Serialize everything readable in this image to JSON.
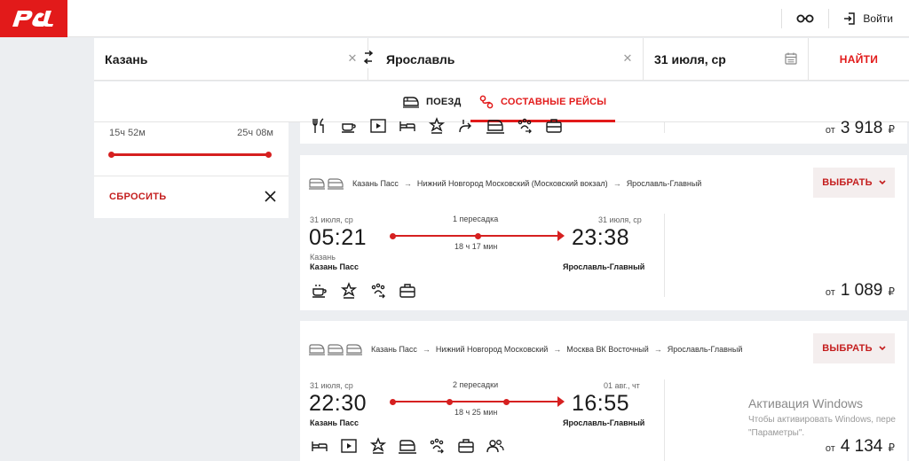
{
  "header": {
    "logo_text": "РЖД",
    "login_label": "Войти"
  },
  "search": {
    "from": "Казань",
    "to": "Ярославль",
    "date": "31 июля, ср",
    "find_label": "НАЙТИ"
  },
  "tabs": [
    {
      "label": "ПОЕЗД",
      "active": false
    },
    {
      "label": "СОСТАВНЫЕ РЕЙСЫ",
      "active": true
    }
  ],
  "filter": {
    "duration_min": "15ч 52м",
    "duration_max": "25ч 08м",
    "reset_label": "СБРОСИТЬ"
  },
  "results": [
    {
      "price_prefix": "от",
      "price": "3 918",
      "currency": "₽"
    },
    {
      "route": [
        "Казань Пасс",
        "Нижний Новгород Московский (Московский вокзал)",
        "Ярославль-Главный"
      ],
      "choose_label": "ВЫБРАТЬ",
      "dep_date": "31 июля, ср",
      "arr_date": "31 июля, ср",
      "dep_time": "05:21",
      "arr_time": "23:38",
      "transfers": "1 пересадка",
      "duration": "18 ч 17 мин",
      "dep_city": "Казань",
      "dep_station": "Казань Пасс",
      "arr_station": "Ярославль-Главный",
      "price_prefix": "от",
      "price": "1 089",
      "currency": "₽"
    },
    {
      "route": [
        "Казань Пасс",
        "Нижний Новгород Московский",
        "Москва ВК Восточный",
        "Ярославль-Главный"
      ],
      "choose_label": "ВЫБРАТЬ",
      "dep_date": "31 июля, ср",
      "arr_date": "01 авг., чт",
      "dep_time": "22:30",
      "arr_time": "16:55",
      "transfers": "2 пересадки",
      "duration": "18 ч 25 мин",
      "dep_station": "Казань Пасс",
      "arr_station": "Ярославль-Главный",
      "price_prefix": "от",
      "price": "4 134",
      "currency": "₽"
    }
  ],
  "watermark": {
    "title": "Активация Windows",
    "line1": "Чтобы активировать Windows, пере",
    "line2": "\"Параметры\"."
  },
  "colors": {
    "brand": "#e21a1a",
    "accent_red": "#d62020",
    "background": "#eceef1"
  }
}
